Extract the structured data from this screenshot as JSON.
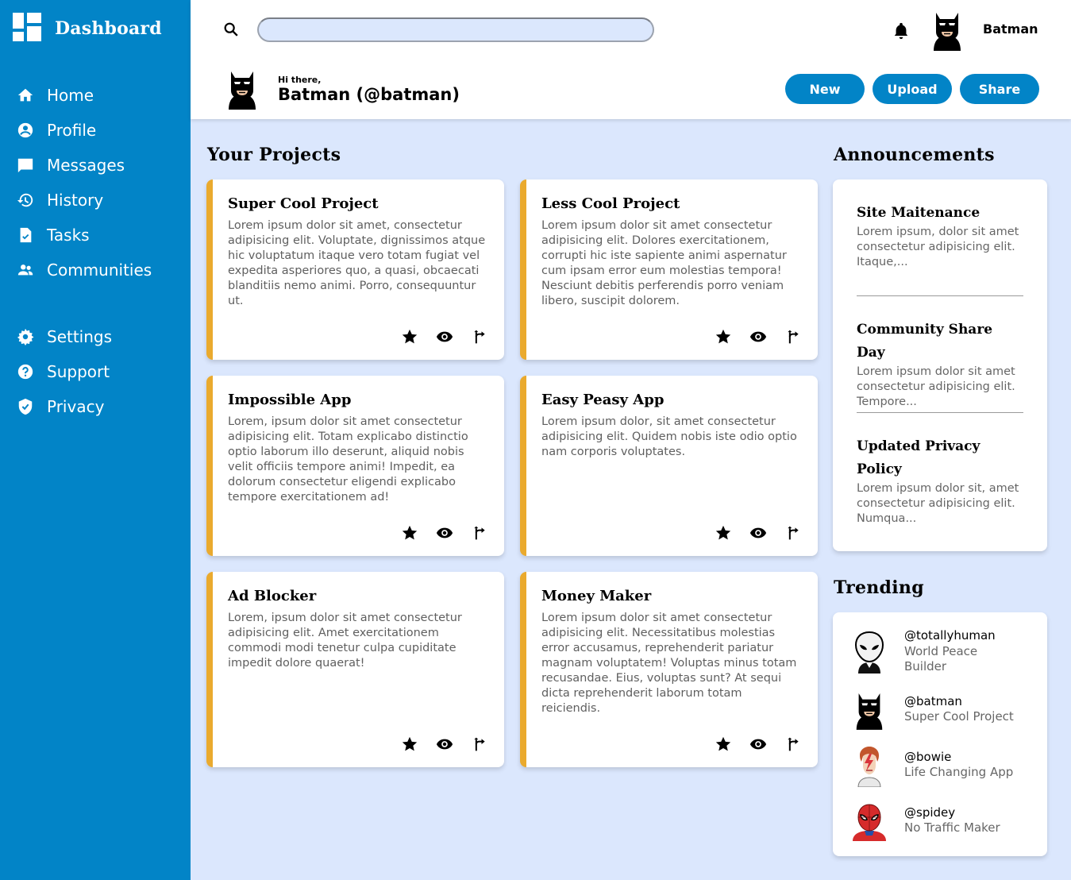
{
  "brand": {
    "title": "Dashboard",
    "icon": "dashboard-grid-icon"
  },
  "sidebar": {
    "items": [
      {
        "label": "Home",
        "icon": "home-icon"
      },
      {
        "label": "Profile",
        "icon": "profile-icon"
      },
      {
        "label": "Messages",
        "icon": "messages-icon"
      },
      {
        "label": "History",
        "icon": "history-icon"
      },
      {
        "label": "Tasks",
        "icon": "tasks-icon"
      },
      {
        "label": "Communities",
        "icon": "communities-icon"
      }
    ],
    "secondary": [
      {
        "label": "Settings",
        "icon": "gear-icon"
      },
      {
        "label": "Support",
        "icon": "help-icon"
      },
      {
        "label": "Privacy",
        "icon": "shield-icon"
      }
    ]
  },
  "header": {
    "search_placeholder": "",
    "username": "Batman",
    "greeting": "Hi there,",
    "display_name": "Batman (@batman)",
    "buttons": {
      "new": "New",
      "upload": "Upload",
      "share": "Share"
    }
  },
  "projects": {
    "title": "Your Projects",
    "items": [
      {
        "title": "Super Cool Project",
        "desc": "Lorem ipsum dolor sit amet, consectetur adipisicing elit. Voluptate, dignissimos atque hic voluptatum itaque vero totam fugiat vel expedita asperiores quo, a quasi, obcaecati blanditiis nemo animi. Porro, consequuntur ut."
      },
      {
        "title": "Less Cool Project",
        "desc": "Lorem ipsum dolor sit amet consectetur adipisicing elit. Dolores exercitationem, corrupti hic iste sapiente animi aspernatur cum ipsam error eum molestias tempora! Nesciunt debitis perferendis porro veniam libero, suscipit dolorem."
      },
      {
        "title": "Impossible App",
        "desc": "Lorem, ipsum dolor sit amet consectetur adipisicing elit. Totam explicabo distinctio optio laborum illo deserunt, aliquid nobis velit officiis tempore animi! Impedit, ea dolorum consectetur eligendi explicabo tempore exercitationem ad!"
      },
      {
        "title": "Easy Peasy App",
        "desc": "Lorem ipsum dolor, sit amet consectetur adipisicing elit. Quidem nobis iste odio optio nam corporis voluptates."
      },
      {
        "title": "Ad Blocker",
        "desc": "Lorem, ipsum dolor sit amet consectetur adipisicing elit. Amet exercitationem commodi modi tenetur culpa cupiditate impedit dolore quaerat!"
      },
      {
        "title": "Money Maker",
        "desc": "Lorem ipsum dolor sit amet consectetur adipisicing elit. Necessitatibus molestias error accusamus, reprehenderit pariatur magnam voluptatem! Voluptas minus totam recusandae. Eius, voluptas sunt? At sequi dicta reprehenderit laborum totam reiciendis."
      }
    ],
    "action_icons": [
      "star-icon",
      "eye-icon",
      "share-fork-icon"
    ]
  },
  "announcements": {
    "title": "Announcements",
    "items": [
      {
        "title": "Site Maitenance",
        "text": "Lorem ipsum, dolor sit amet consectetur adipisicing elit. Itaque,..."
      },
      {
        "title": "Community Share Day",
        "text": "Lorem ipsum dolor sit amet consectetur adipisicing elit. Tempore..."
      },
      {
        "title": "Updated Privacy Policy",
        "text": "Lorem ipsum dolor sit, amet consectetur adipisicing elit. Numqua..."
      }
    ]
  },
  "trending": {
    "title": "Trending",
    "items": [
      {
        "handle": "@totallyhuman",
        "subtitle": "World Peace Builder",
        "avatar": "alien-avatar"
      },
      {
        "handle": "@batman",
        "subtitle": "Super Cool Project",
        "avatar": "batman-avatar"
      },
      {
        "handle": "@bowie",
        "subtitle": "Life Changing App",
        "avatar": "bowie-avatar"
      },
      {
        "handle": "@spidey",
        "subtitle": "No Traffic Maker",
        "avatar": "spiderman-avatar"
      }
    ]
  },
  "colors": {
    "sidebar": "#0284c7",
    "accent": "#eaaa2e",
    "background": "#dbe7fd",
    "button": "#0284c7"
  }
}
